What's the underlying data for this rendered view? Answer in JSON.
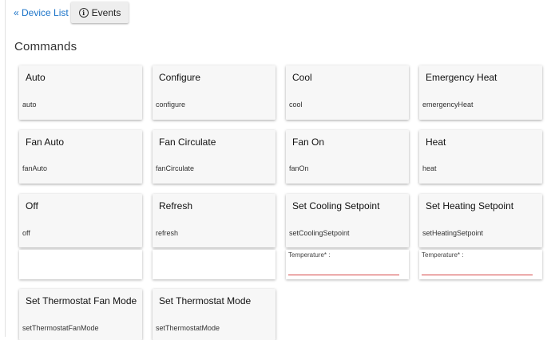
{
  "nav": {
    "device_list_label": "« Device List",
    "events_label": "Events",
    "events_icon": "info-icon"
  },
  "section": {
    "title": "Commands"
  },
  "commands": {
    "auto": {
      "label": "Auto",
      "cmd": "auto"
    },
    "configure": {
      "label": "Configure",
      "cmd": "configure"
    },
    "cool": {
      "label": "Cool",
      "cmd": "cool"
    },
    "emergency_heat": {
      "label": "Emergency Heat",
      "cmd": "emergencyHeat"
    },
    "fan_auto": {
      "label": "Fan Auto",
      "cmd": "fanAuto"
    },
    "fan_circulate": {
      "label": "Fan Circulate",
      "cmd": "fanCirculate"
    },
    "fan_on": {
      "label": "Fan On",
      "cmd": "fanOn"
    },
    "heat": {
      "label": "Heat",
      "cmd": "heat"
    },
    "off": {
      "label": "Off",
      "cmd": "off"
    },
    "refresh": {
      "label": "Refresh",
      "cmd": "refresh"
    },
    "set_cooling_setpoint": {
      "label": "Set Cooling Setpoint",
      "cmd": "setCoolingSetpoint",
      "param_label": "Temperature* :"
    },
    "set_heating_setpoint": {
      "label": "Set Heating Setpoint",
      "cmd": "setHeatingSetpoint",
      "param_label": "Temperature* :"
    },
    "set_thermostat_fan_mode": {
      "label": "Set Thermostat Fan Mode",
      "cmd": "setThermostatFanMode"
    },
    "set_thermostat_mode": {
      "label": "Set Thermostat Mode",
      "cmd": "setThermostatMode"
    }
  },
  "colors": {
    "link": "#1a73c8",
    "input_underline": "#d64545",
    "card_bg": "#f7f7f7"
  }
}
